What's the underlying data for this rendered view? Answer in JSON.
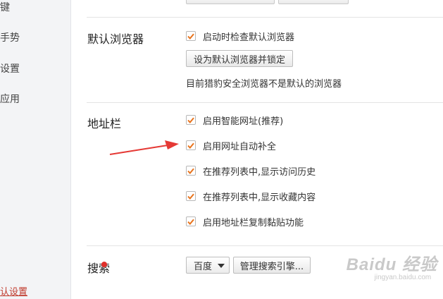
{
  "sidebar": {
    "items": [
      {
        "label": "键"
      },
      {
        "label": "手势"
      },
      {
        "label": "设置"
      },
      {
        "label": "应用"
      },
      {
        "label": "认设置"
      }
    ]
  },
  "default_browser": {
    "title": "默认浏览器",
    "check_on_startup": {
      "label": "启动时检查默认浏览器",
      "checked": true
    },
    "set_default_button": "设为默认浏览器并锁定",
    "status_text": "目前猎豹安全浏览器不是默认的浏览器"
  },
  "address_bar": {
    "title": "地址栏",
    "options": [
      {
        "label": "启用智能网址(推荐)",
        "checked": true
      },
      {
        "label": "启用网址自动补全",
        "checked": true
      },
      {
        "label": "在推荐列表中,显示访问历史",
        "checked": true
      },
      {
        "label": "在推荐列表中,显示收藏内容",
        "checked": true
      },
      {
        "label": "启用地址栏复制黏贴功能",
        "checked": true
      }
    ]
  },
  "search": {
    "title": "搜索",
    "engine_selected": "百度",
    "manage_button": "管理搜索引擎..."
  },
  "watermark": {
    "main": "Baidu 经验",
    "sub": "jingyan.baidu.com"
  },
  "colors": {
    "checkmark": "#e8731c",
    "annotation_arrow": "#e53935",
    "sidebar_bg": "#f3f4f6"
  }
}
